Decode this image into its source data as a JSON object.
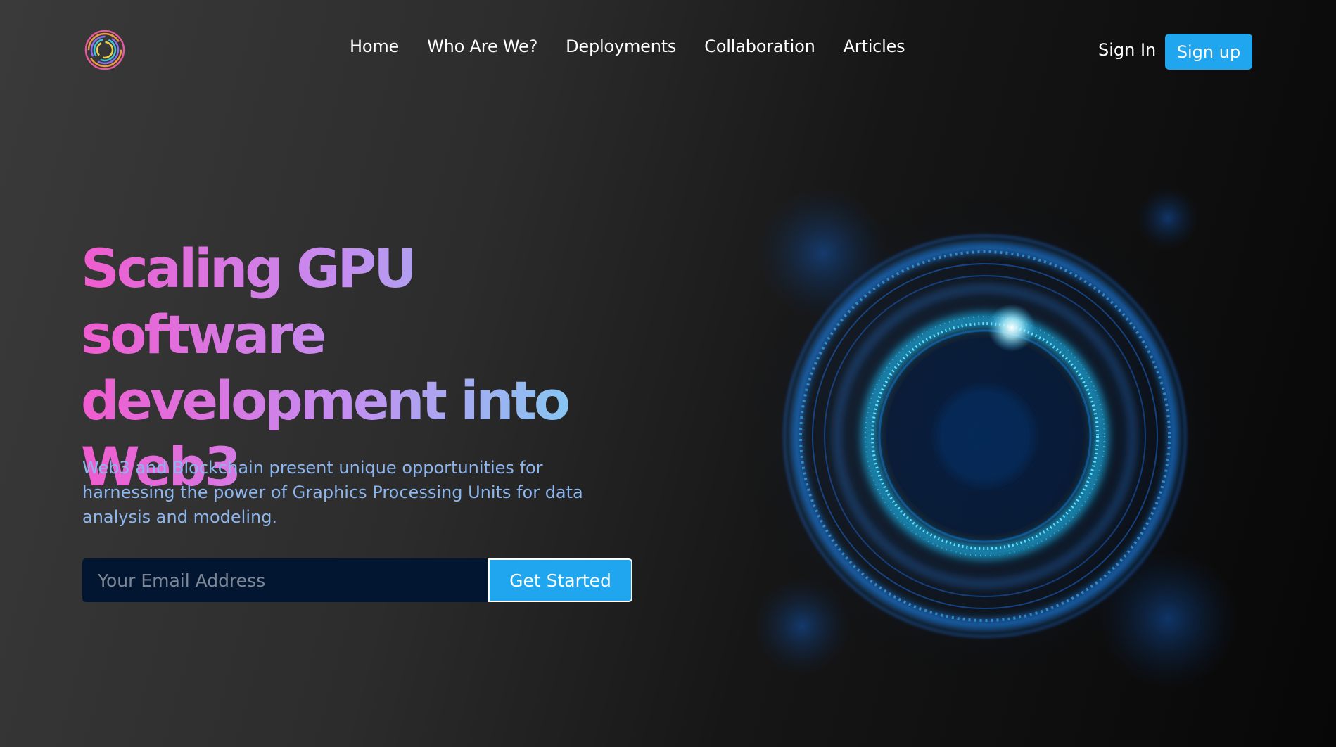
{
  "header": {
    "logo_icon": "rainbow-ring-logo",
    "nav": [
      "Home",
      "Who Are We?",
      "Deployments",
      "Collaboration",
      "Articles"
    ],
    "sign_in": "Sign In",
    "sign_up": "Sign up"
  },
  "hero": {
    "headline": "Scaling GPU software development into Web3",
    "subtext": "Web3 and Blockchain present unique opportunities for harnessing the power of Graphics Processing Units for data analysis and modeling.",
    "email_placeholder": "Your Email Address",
    "cta": "Get Started",
    "illustration": "glowing-blue-ring"
  },
  "colors": {
    "accent": "#1fa6ee",
    "headline_gradient": [
      "#f05ccf",
      "#c58df0",
      "#6fdcf2"
    ],
    "subtext": "#8db6ee",
    "input_bg": "#021632"
  }
}
